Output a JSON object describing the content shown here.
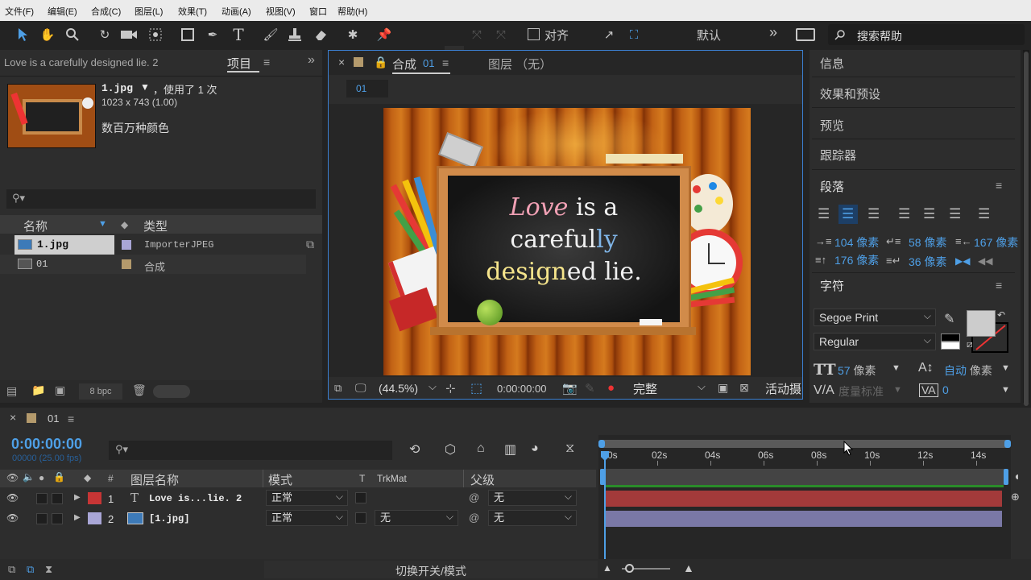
{
  "menu": [
    "文件(F)",
    "编辑(E)",
    "合成(C)",
    "图层(L)",
    "效果(T)",
    "动画(A)",
    "视图(V)",
    "窗口",
    "帮助(H)"
  ],
  "toolbar": {
    "align_label": "对齐",
    "workspace": "默认",
    "search_help": "搜索帮助"
  },
  "project": {
    "comp_title": "Love is a  carefully  designed lie. 2",
    "tab": "项目",
    "file_name": "1.jpg",
    "usage": "，使用了 1 次",
    "dimensions": "1023 x 743 (1.00)",
    "colors": "数百万种颜色",
    "col_name": "名称",
    "col_type": "类型",
    "items": [
      {
        "name": "1.jpg",
        "type": "ImporterJPEG"
      },
      {
        "name": "01",
        "type": "合成"
      }
    ],
    "bpc": "8 bpc"
  },
  "comp_panel": {
    "tab": "合成",
    "tab_num": "01",
    "layer_tab": "图层 （无）",
    "breadcrumb": "01",
    "zoom": "(44.5%)",
    "timecode": "0:00:00:00",
    "quality": "完整",
    "active_camera": "活动摄"
  },
  "chalk": {
    "line1a": "Love",
    "line1b": " is a",
    "line2a": "careful",
    "line2b": "ly",
    "line3a": "design",
    "line3b": "ed lie."
  },
  "right": {
    "info": "信息",
    "effects": "效果和预设",
    "preview": "预览",
    "tracker": "跟踪器",
    "paragraph": "段落",
    "indent_left": "104 像素",
    "space_before": "58 像素",
    "indent_right": "167 像素",
    "first_indent": "176 像素",
    "space_after": "36 像素",
    "character": "字符",
    "font": "Segoe Print",
    "style": "Regular",
    "font_size": "57",
    "font_unit": "像素",
    "leading": "自动",
    "leading_unit": "像素",
    "kerning": "度量标准",
    "tracking": "0"
  },
  "timeline": {
    "comp": "01",
    "timecode": "0:00:00:00",
    "fps": "00000 (25.00 fps)",
    "col_name": "图层名称",
    "col_mode": "模式",
    "col_t": "T",
    "col_trkmat": "TrkMat",
    "col_parent": "父级",
    "ruler": [
      "0s",
      "02s",
      "04s",
      "06s",
      "08s",
      "10s",
      "12s",
      "14s"
    ],
    "layers": [
      {
        "num": "1",
        "name": "Love is...lie. 2",
        "mode": "正常",
        "trkmat": "",
        "parent": "无",
        "color": "#c73535"
      },
      {
        "num": "2",
        "name": "[1.jpg]",
        "mode": "正常",
        "trkmat": "无",
        "parent": "无",
        "color": "#a9a6d6"
      }
    ],
    "switch_modes": "切换开关/模式"
  },
  "colors": {
    "accent": "#4e9fe6",
    "layer1_bar": "#a33a3a",
    "layer2_bar": "#7a78a6",
    "workarea": "#2a8c2a"
  }
}
